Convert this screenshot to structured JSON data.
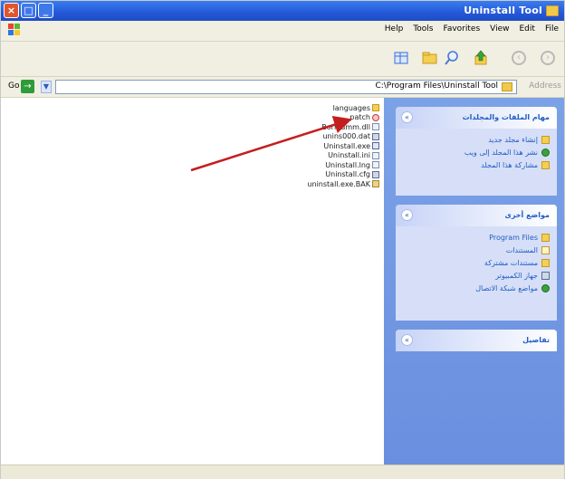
{
  "window": {
    "title": "Uninstall Tool",
    "buttons": {
      "close": "×",
      "maximize": "□",
      "minimize": "_"
    }
  },
  "menu": {
    "items": [
      "Help",
      "Tools",
      "Favorites",
      "View",
      "Edit",
      "File"
    ]
  },
  "toolbar": {
    "icons": [
      "views-icon",
      "folders-icon",
      "search-icon",
      "up-folder-icon",
      "back-icon",
      "forward-icon"
    ]
  },
  "address": {
    "go_label": "Go",
    "path": "C:\\Program Files\\Uninstall Tool",
    "label": "Address"
  },
  "files": [
    {
      "name": "languages",
      "icon": "folder"
    },
    {
      "name": "patch",
      "icon": "patch"
    },
    {
      "name": "Borlndmm.dll",
      "icon": "doc"
    },
    {
      "name": "unins000.dat",
      "icon": "cfg"
    },
    {
      "name": "Uninstall.exe",
      "icon": "exe"
    },
    {
      "name": "Uninstall.ini",
      "icon": "doc"
    },
    {
      "name": "Uninstall.lng",
      "icon": "doc"
    },
    {
      "name": "Uninstall.cfg",
      "icon": "cfg"
    },
    {
      "name": "uninstall.exe.BAK",
      "icon": "arc"
    }
  ],
  "taskpane": {
    "tasks_title": "مهام الملفات والمجلدات",
    "tasks": [
      {
        "label": "إنشاء مجلد جديد",
        "icon": "folder"
      },
      {
        "label": "نشر هذا المجلد إلى ويب",
        "icon": "globe"
      },
      {
        "label": "مشاركة هذا المجلد",
        "icon": "folder"
      }
    ],
    "places_title": "مواضع أخرى",
    "places": [
      {
        "label": "Program Files",
        "icon": "folder"
      },
      {
        "label": "المستندات",
        "icon": "doc"
      },
      {
        "label": "مستندات مشتركة",
        "icon": "folder"
      },
      {
        "label": "جهاز الكمبيوتر",
        "icon": "computer"
      },
      {
        "label": "مواضع شبكة الاتصال",
        "icon": "network"
      }
    ],
    "details_title": "تفاصيل",
    "toggle": "«"
  },
  "colors": {
    "titlebar": "#2458d8",
    "taskpane": "#6a8fdf",
    "link": "#215dc6",
    "arrow": "#c41e1e"
  }
}
